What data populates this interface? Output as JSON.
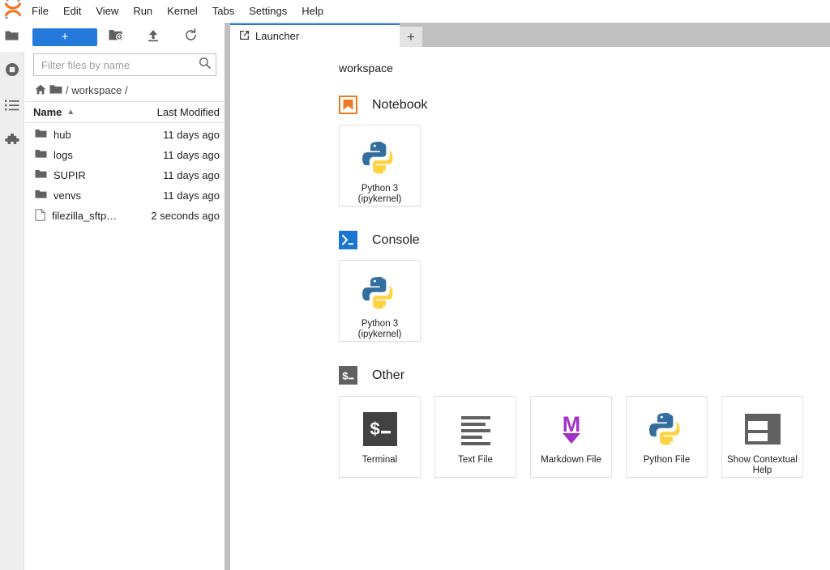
{
  "app": {
    "logo_icon": "jupyter-logo"
  },
  "menubar": {
    "items": [
      {
        "label": "File"
      },
      {
        "label": "Edit"
      },
      {
        "label": "View"
      },
      {
        "label": "Run"
      },
      {
        "label": "Kernel"
      },
      {
        "label": "Tabs"
      },
      {
        "label": "Settings"
      },
      {
        "label": "Help"
      }
    ]
  },
  "sidebar": {
    "items": [
      {
        "name": "file-browser",
        "icon": "folder-icon",
        "active": true
      },
      {
        "name": "running-terminals-kernels",
        "icon": "running-icon",
        "active": false
      },
      {
        "name": "table-of-contents",
        "icon": "list-icon",
        "active": false
      },
      {
        "name": "extension-manager",
        "icon": "puzzle-icon",
        "active": false
      }
    ]
  },
  "filebrowser": {
    "toolbar": {
      "new_launcher_label": "+",
      "new_folder_icon": "new-folder-icon",
      "upload_icon": "upload-icon",
      "refresh_icon": "refresh-icon"
    },
    "filter": {
      "placeholder": "Filter files by name",
      "value": ""
    },
    "breadcrumb": {
      "home_icon": "home-icon",
      "folder_icon": "folder-icon",
      "path": "/ workspace /"
    },
    "columns": {
      "name": "Name",
      "last_modified": "Last Modified",
      "sort_arrow": "▲"
    },
    "rows": [
      {
        "icon": "folder-icon",
        "name": "hub",
        "modified": "11 days ago"
      },
      {
        "icon": "folder-icon",
        "name": "logs",
        "modified": "11 days ago"
      },
      {
        "icon": "folder-icon",
        "name": "SUPIR",
        "modified": "11 days ago"
      },
      {
        "icon": "folder-icon",
        "name": "venvs",
        "modified": "11 days ago"
      },
      {
        "icon": "file-icon",
        "name": "filezilla_sftp…",
        "modified": "2 seconds ago"
      }
    ]
  },
  "tabbar": {
    "tabs": [
      {
        "label": "Launcher",
        "icon": "launcher-icon",
        "active": true
      }
    ],
    "add_tab_label": "+"
  },
  "launcher": {
    "workspace_label": "workspace",
    "sections": [
      {
        "title": "Notebook",
        "icon": "notebook-icon",
        "cards": [
          {
            "icon": "python-logo-icon",
            "label": "Python 3\n(ipykernel)",
            "line1": "Python 3",
            "line2": "(ipykernel)"
          }
        ]
      },
      {
        "title": "Console",
        "icon": "console-icon",
        "cards": [
          {
            "icon": "python-logo-icon",
            "label": "Python 3\n(ipykernel)",
            "line1": "Python 3",
            "line2": "(ipykernel)"
          }
        ]
      },
      {
        "title": "Other",
        "icon": "terminal-prompt-icon",
        "cards": [
          {
            "icon": "terminal-icon",
            "line1": "Terminal",
            "line2": ""
          },
          {
            "icon": "text-file-icon",
            "line1": "Text File",
            "line2": ""
          },
          {
            "icon": "markdown-icon",
            "line1": "Markdown File",
            "line2": ""
          },
          {
            "icon": "python-logo-icon",
            "line1": "Python File",
            "line2": ""
          },
          {
            "icon": "contextual-help-icon",
            "line1": "Show Contextual",
            "line2": "Help"
          }
        ]
      }
    ]
  },
  "colors": {
    "accent_blue": "#2579da",
    "notebook_orange": "#ee7b24",
    "console_blue": "#1976d2",
    "other_gray": "#616161",
    "markdown_purple": "#a333c8",
    "terminal_dark": "#424242",
    "tabbar_gray": "#c0c0c0",
    "python_blue": "#326f9f",
    "python_yellow": "#ffd242"
  }
}
